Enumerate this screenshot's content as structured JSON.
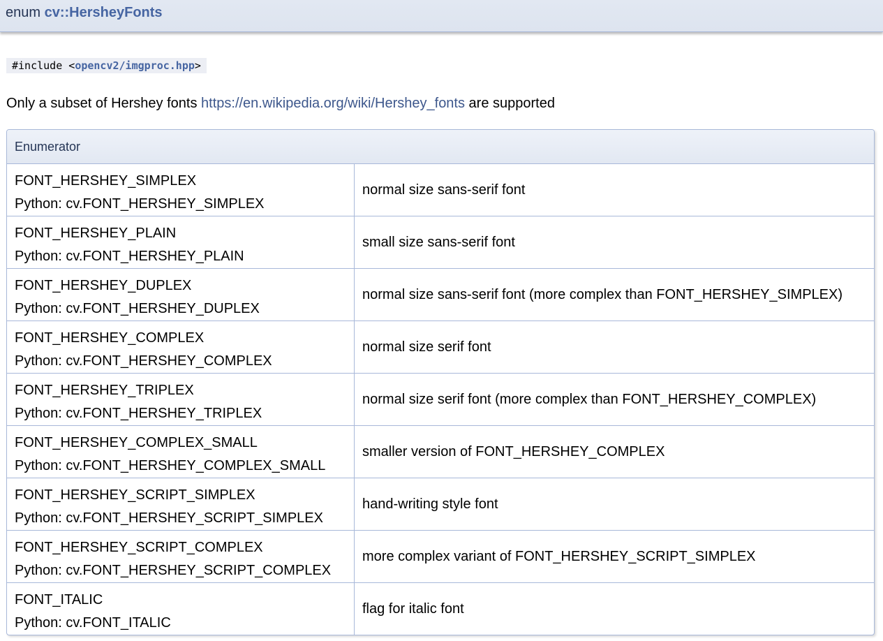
{
  "header": {
    "enum_keyword": "enum",
    "enum_name": "cv::HersheyFonts"
  },
  "include": {
    "prefix": "#include <",
    "file": "opencv2/imgproc.hpp",
    "suffix": ">"
  },
  "description": {
    "before_link": "Only a subset of Hershey fonts ",
    "link_text": "https://en.wikipedia.org/wiki/Hershey_fonts",
    "after_link": " are supported"
  },
  "table": {
    "header": "Enumerator",
    "rows": [
      {
        "name": "FONT_HERSHEY_SIMPLEX",
        "python": "Python: cv.FONT_HERSHEY_SIMPLEX",
        "doc": "normal size sans-serif font"
      },
      {
        "name": "FONT_HERSHEY_PLAIN",
        "python": "Python: cv.FONT_HERSHEY_PLAIN",
        "doc": "small size sans-serif font"
      },
      {
        "name": "FONT_HERSHEY_DUPLEX",
        "python": "Python: cv.FONT_HERSHEY_DUPLEX",
        "doc": "normal size sans-serif font (more complex than FONT_HERSHEY_SIMPLEX)"
      },
      {
        "name": "FONT_HERSHEY_COMPLEX",
        "python": "Python: cv.FONT_HERSHEY_COMPLEX",
        "doc": "normal size serif font"
      },
      {
        "name": "FONT_HERSHEY_TRIPLEX",
        "python": "Python: cv.FONT_HERSHEY_TRIPLEX",
        "doc": "normal size serif font (more complex than FONT_HERSHEY_COMPLEX)"
      },
      {
        "name": "FONT_HERSHEY_COMPLEX_SMALL",
        "python": "Python: cv.FONT_HERSHEY_COMPLEX_SMALL",
        "doc": "smaller version of FONT_HERSHEY_COMPLEX"
      },
      {
        "name": "FONT_HERSHEY_SCRIPT_SIMPLEX",
        "python": "Python: cv.FONT_HERSHEY_SCRIPT_SIMPLEX",
        "doc": "hand-writing style font"
      },
      {
        "name": "FONT_HERSHEY_SCRIPT_COMPLEX",
        "python": "Python: cv.FONT_HERSHEY_SCRIPT_COMPLEX",
        "doc": "more complex variant of FONT_HERSHEY_SCRIPT_SIMPLEX"
      },
      {
        "name": "FONT_ITALIC",
        "python": "Python: cv.FONT_ITALIC",
        "doc": "flag for italic font"
      }
    ]
  }
}
